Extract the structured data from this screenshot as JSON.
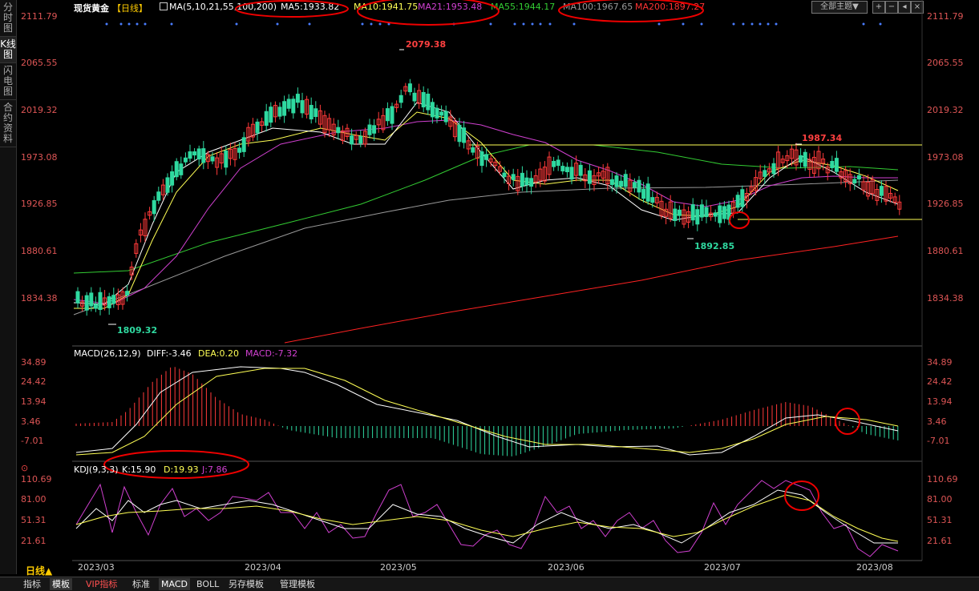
{
  "side_tabs": [
    "分时图",
    "K线图",
    "闪电图",
    "合约资料"
  ],
  "header": {
    "title": "现货黄金",
    "period": "【日线】",
    "ma_params": "MA(5,10,21,55,100,200)",
    "ma5": "MA5:1933.82",
    "ma10": "MA10:1941.75",
    "ma21": "MA21:1953.48",
    "ma55": "MA55:1944.17",
    "ma100": "MA100:1967.65",
    "ma200": "MA200:1897.27",
    "theme_button": "全部主题▼"
  },
  "price_axis": [
    "2111.79",
    "2065.55",
    "2019.32",
    "1973.08",
    "1926.85",
    "1880.61",
    "1834.38"
  ],
  "annotations": {
    "high": "2079.38",
    "low_start": "1809.32",
    "low_mid": "1892.85",
    "recent_high": "1987.34"
  },
  "macd": {
    "label": "MACD(26,12,9)",
    "diff": "DIFF:-3.46",
    "dea": "DEA:0.20",
    "macd": "MACD:-7.32",
    "axis": [
      "34.89",
      "24.42",
      "13.94",
      "3.46",
      "-7.01"
    ]
  },
  "kdj": {
    "label": "KDJ(9,3,3)",
    "k": "K:15.90",
    "d": "D:19.93",
    "j": "J:7.86",
    "axis": [
      "110.69",
      "81.00",
      "51.31",
      "21.61"
    ]
  },
  "dates": [
    "2023/03",
    "2023/04",
    "2023/05",
    "2023/06",
    "2023/07",
    "2023/08"
  ],
  "bottom": {
    "period": "日线▲",
    "tabs": [
      "指标",
      "模板",
      "VIP指标",
      "标准",
      "MACD",
      "BOLL",
      "另存模板",
      "管理模板"
    ]
  },
  "colors": {
    "up": "#ff3a3a",
    "down": "#2fd9a0",
    "ma5": "#ffffff",
    "ma10": "#ffff55",
    "ma21": "#d040d0",
    "ma55": "#33cc33",
    "ma100": "#999999",
    "ma200": "#ff2222"
  }
}
